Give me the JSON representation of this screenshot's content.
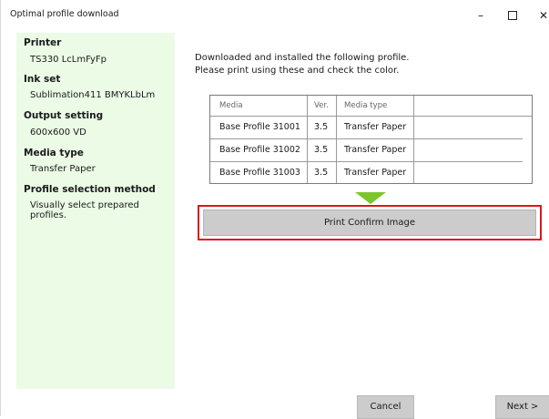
{
  "window": {
    "title": "Optimal profile download",
    "minimize": "–",
    "close": "✕"
  },
  "sidebar": {
    "printer_label": "Printer",
    "printer_value": "TS330 LcLmFyFp",
    "inkset_label": "Ink set",
    "inkset_value": "Sublimation411 BMYKLbLm",
    "output_label": "Output setting",
    "output_value": "600x600 VD",
    "media_label": "Media type",
    "media_value": "Transfer Paper",
    "method_label": "Profile selection method",
    "method_value": "Visually select prepared profiles."
  },
  "main": {
    "message_line1": "Downloaded and installed the following profile.",
    "message_line2": "Please print using these and check the color."
  },
  "table": {
    "headers": [
      "Media",
      "Ver.",
      "Media type",
      ""
    ],
    "rows": [
      [
        "Base Profile 31001",
        "3.5",
        "Transfer Paper",
        ""
      ],
      [
        "Base Profile 31002",
        "3.5",
        "Transfer Paper",
        ""
      ],
      [
        "Base Profile 31003",
        "3.5",
        "Transfer Paper",
        ""
      ]
    ]
  },
  "actions": {
    "print_confirm_label": "Print Confirm Image",
    "cancel_label": "Cancel",
    "next_label": "Next >"
  },
  "colors": {
    "sidebar_bg": "#ebfbe6",
    "arrow": "#7dc52e",
    "highlight": "#e0141e",
    "button_bg": "#cccccc"
  },
  "icons": {
    "arrow": "down-arrow-icon",
    "minimize": "minimize-icon",
    "maximize": "maximize-icon",
    "close": "close-icon"
  }
}
